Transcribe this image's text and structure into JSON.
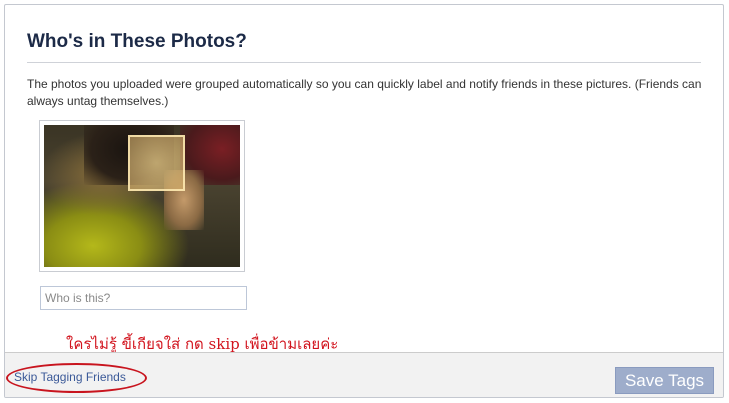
{
  "dialog": {
    "title": "Who's in These Photos?",
    "description": "The photos you uploaded were grouped automatically so you can quickly label and notify friends in these pictures. (Friends can always untag themselves.)",
    "tag_input": {
      "placeholder": "Who is this?",
      "value": ""
    }
  },
  "annotation": {
    "text": "ใครไม่รู้ ขี้เกียจใส่ กด skip เพื่อข้ามเลยค่ะ",
    "color": "#d2141e"
  },
  "footer": {
    "skip_label": "Skip Tagging Friends",
    "save_label": "Save Tags"
  },
  "colors": {
    "title": "#1c2a47",
    "link": "#3b5998",
    "save_button_bg": "#9eadcb",
    "footer_bg": "#f2f2f2"
  }
}
